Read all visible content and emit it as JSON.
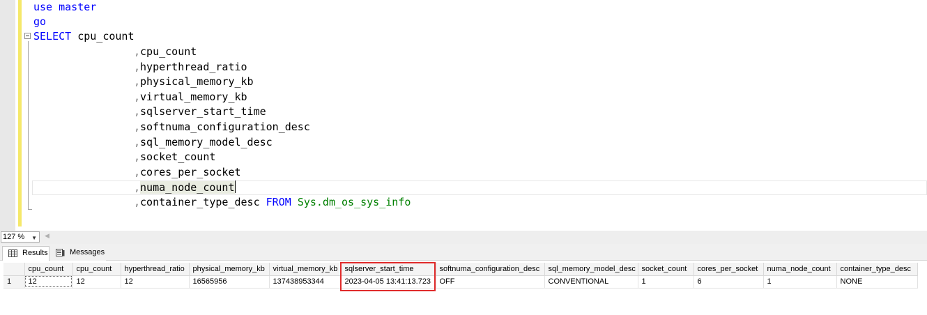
{
  "editor": {
    "line1": {
      "kw": "use",
      "ident": "master"
    },
    "line2": {
      "kw": "go"
    },
    "line3": {
      "kw": "SELECT",
      "ident": "cpu_count"
    },
    "comma": ",",
    "columns": [
      "cpu_count",
      "hyperthread_ratio",
      "physical_memory_kb",
      "virtual_memory_kb",
      "sqlserver_start_time",
      "softnuma_configuration_desc",
      "sql_memory_model_desc",
      "socket_count",
      "cores_per_socket",
      "numa_node_count",
      "container_type_desc"
    ],
    "from_kw": "FROM",
    "table_name": "Sys.dm_os_sys_info"
  },
  "zoom": {
    "value": "127 %"
  },
  "tabs": {
    "results": "Results",
    "messages": "Messages"
  },
  "grid": {
    "headers": [
      "cpu_count",
      "cpu_count",
      "hyperthread_ratio",
      "physical_memory_kb",
      "virtual_memory_kb",
      "sqlserver_start_time",
      "softnuma_configuration_desc",
      "sql_memory_model_desc",
      "socket_count",
      "cores_per_socket",
      "numa_node_count",
      "container_type_desc"
    ],
    "rows": [
      {
        "num": "1",
        "cells": [
          "12",
          "12",
          "12",
          "16565956",
          "137438953344",
          "2023-04-05 13:41:13.723",
          "OFF",
          "CONVENTIONAL",
          "1",
          "6",
          "1",
          "NONE"
        ]
      }
    ]
  },
  "colors": {
    "keyword": "#0000ff",
    "object": "#008000",
    "operator": "#808080",
    "change_bar": "#f5e86a",
    "highlight_box": "#e02b2b"
  },
  "icons": [
    "collapse-icon",
    "grid-icon",
    "messages-icon",
    "dropdown-arrow-icon",
    "scroll-left-icon"
  ]
}
